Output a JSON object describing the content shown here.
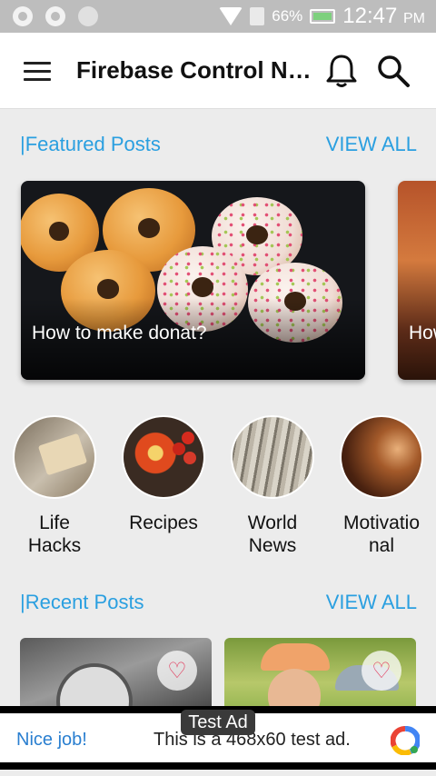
{
  "status_bar": {
    "battery_percent": "66%",
    "time": "12:47",
    "ampm": "PM",
    "icons": [
      "notification-dot-icon",
      "ring-notification-icon",
      "circle-status-icon",
      "wifi-icon",
      "sim-icon",
      "battery-charging-icon"
    ]
  },
  "app_bar": {
    "title": "Firebase Control News App",
    "icons": [
      "menu-icon",
      "bell-icon",
      "search-icon"
    ]
  },
  "featured": {
    "title": "|Featured Posts",
    "view_all": "VIEW ALL",
    "cards": [
      {
        "caption": "How to make donat?"
      },
      {
        "caption": "How"
      }
    ]
  },
  "categories": [
    {
      "label_line1": "Life",
      "label_line2": "Hacks"
    },
    {
      "label_line1": "Recipes",
      "label_line2": ""
    },
    {
      "label_line1": "World",
      "label_line2": "News"
    },
    {
      "label_line1": "Motivatio",
      "label_line2": "nal"
    }
  ],
  "recent": {
    "title": "|Recent Posts",
    "view_all": "VIEW ALL",
    "favorite_icon": "heart-outline-icon"
  },
  "ad": {
    "badge": "Test Ad",
    "cta": "Nice job!",
    "text": "This is a 468x60 test ad.",
    "icon": "ad-choices-logo-icon"
  },
  "colors": {
    "accent": "#2a9fe0",
    "heart": "#e23a5c",
    "status_bar": "#bdbdbd"
  }
}
